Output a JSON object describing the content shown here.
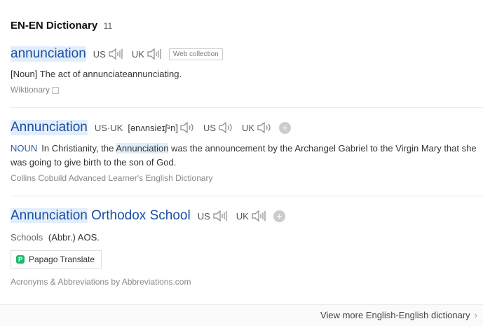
{
  "header": {
    "title": "EN-EN Dictionary",
    "count": "11"
  },
  "entries": [
    {
      "word": "annunciation",
      "us_label": "US",
      "uk_label": "UK",
      "tag": "Web collection",
      "pos": "[Noun]",
      "definition": "The act of annunciateannunciating.",
      "source": "Wiktionary"
    },
    {
      "word": "Annunciation",
      "usuk_label": "US·UK",
      "phonetic": "[ənʌnsieɪʃᵊn]",
      "us_label": "US",
      "uk_label": "UK",
      "pos": "NOUN",
      "definition_pre": "In Christianity, the ",
      "definition_hl": "Annunciation",
      "definition_post": " was the announcement by the Archangel Gabriel to the Virgin Mary that she was going to give birth to the son of God.",
      "source": "Collins Cobuild Advanced Learner's English Dictionary"
    },
    {
      "word_hl": "Annunciation",
      "word_rest": " Orthodox School",
      "us_label": "US",
      "uk_label": "UK",
      "category": "Schools",
      "definition": "(Abbr.) AOS.",
      "translate_button": "Papago Translate",
      "source": "Acronyms & Abbreviations by Abbreviations.com"
    }
  ],
  "footer": {
    "view_more": "View more English-English dictionary"
  },
  "icons": {
    "speaker": "speaker-icon",
    "copy": "copy-icon",
    "plus": "plus-icon",
    "chevron": "chevron-right-icon"
  }
}
